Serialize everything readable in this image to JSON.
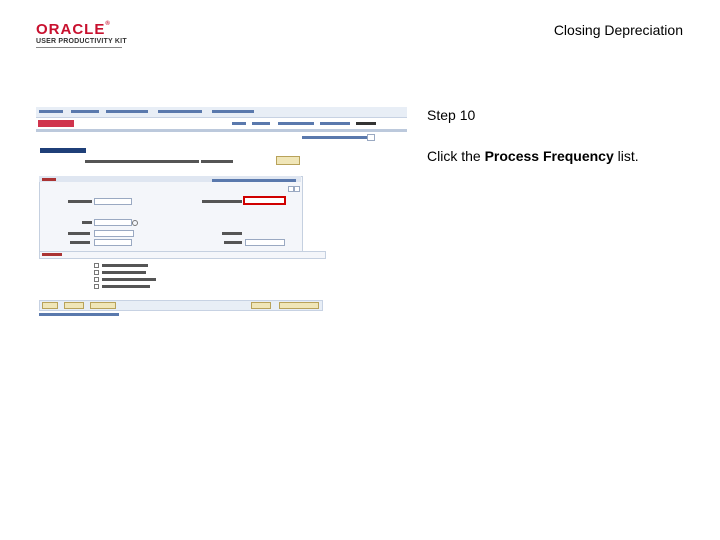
{
  "header": {
    "brand": "ORACLE",
    "subtitle": "USER PRODUCTIVITY KIT",
    "doc_title": "Closing Depreciation"
  },
  "step": {
    "label": "Step 10",
    "instruction_prefix": "Click the ",
    "instruction_bold": "Process Frequency",
    "instruction_suffix": " list."
  },
  "colors": {
    "brand_red": "#c8102e",
    "highlight_red": "#d00000",
    "nav_blue": "#2a4a8a"
  }
}
